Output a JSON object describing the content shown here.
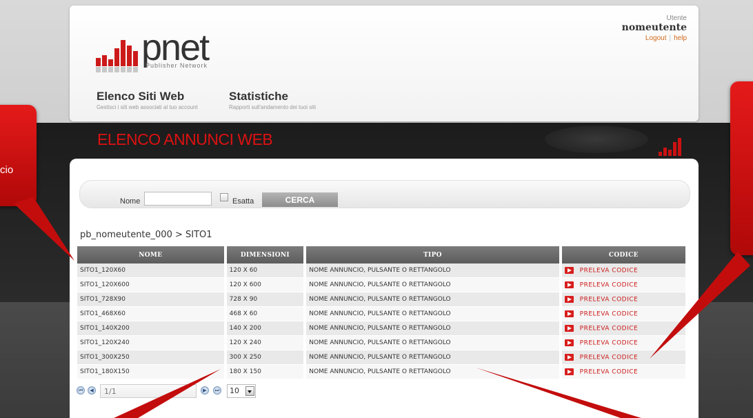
{
  "header": {
    "logo": {
      "word": "pnet",
      "tagline": "Publisher Network"
    },
    "user": {
      "label": "Utente",
      "name": "nomeutente",
      "logout": "Logout",
      "help": "help"
    },
    "nav": [
      {
        "title": "Elenco Siti Web",
        "subtitle": "Gestisci i siti web associati al tuo account"
      },
      {
        "title": "Statistiche",
        "subtitle": "Rapporti sull'andamento dei tuoi siti"
      }
    ]
  },
  "page_title": "ELENCO ANNUNCI WEB",
  "search": {
    "name_label": "Nome",
    "name_value": "",
    "exact_label": "Esatta",
    "button": "CERCA"
  },
  "breadcrumb": "pb_nomeutente_000 > SITO1",
  "table": {
    "headers": [
      "NOME",
      "DIMENSIONI",
      "TIPO",
      "CODICE"
    ],
    "rows": [
      [
        "SITO1_120X60",
        "120 X 60",
        "NOME ANNUNCIO, PULSANTE O RETTANGOLO",
        "PRELEVA CODICE"
      ],
      [
        "SITO1_120X600",
        "120 X 600",
        "NOME ANNUNCIO, PULSANTE O RETTANGOLO",
        "PRELEVA CODICE"
      ],
      [
        "SITO1_728X90",
        "728 X 90",
        "NOME ANNUNCIO, PULSANTE O RETTANGOLO",
        "PRELEVA CODICE"
      ],
      [
        "SITO1_468X60",
        "468 X 60",
        "NOME ANNUNCIO, PULSANTE O RETTANGOLO",
        "PRELEVA CODICE"
      ],
      [
        "SITO1_140X200",
        "140 X 200",
        "NOME ANNUNCIO, PULSANTE O RETTANGOLO",
        "PRELEVA CODICE"
      ],
      [
        "SITO1_120X240",
        "120 X 240",
        "NOME ANNUNCIO, PULSANTE O RETTANGOLO",
        "PRELEVA CODICE"
      ],
      [
        "SITO1_300X250",
        "300 X 250",
        "NOME ANNUNCIO, PULSANTE O RETTANGOLO",
        "PRELEVA CODICE"
      ],
      [
        "SITO1_180X150",
        "180 X 150",
        "NOME ANNUNCIO, PULSANTE O RETTANGOLO",
        "PRELEVA CODICE"
      ]
    ]
  },
  "pager": {
    "page": "1/1",
    "page_size": "10"
  },
  "callouts": {
    "left_text": "cio"
  },
  "colors": {
    "accent_red": "#cc1a1a",
    "header_grey": "#6b6b6b"
  }
}
